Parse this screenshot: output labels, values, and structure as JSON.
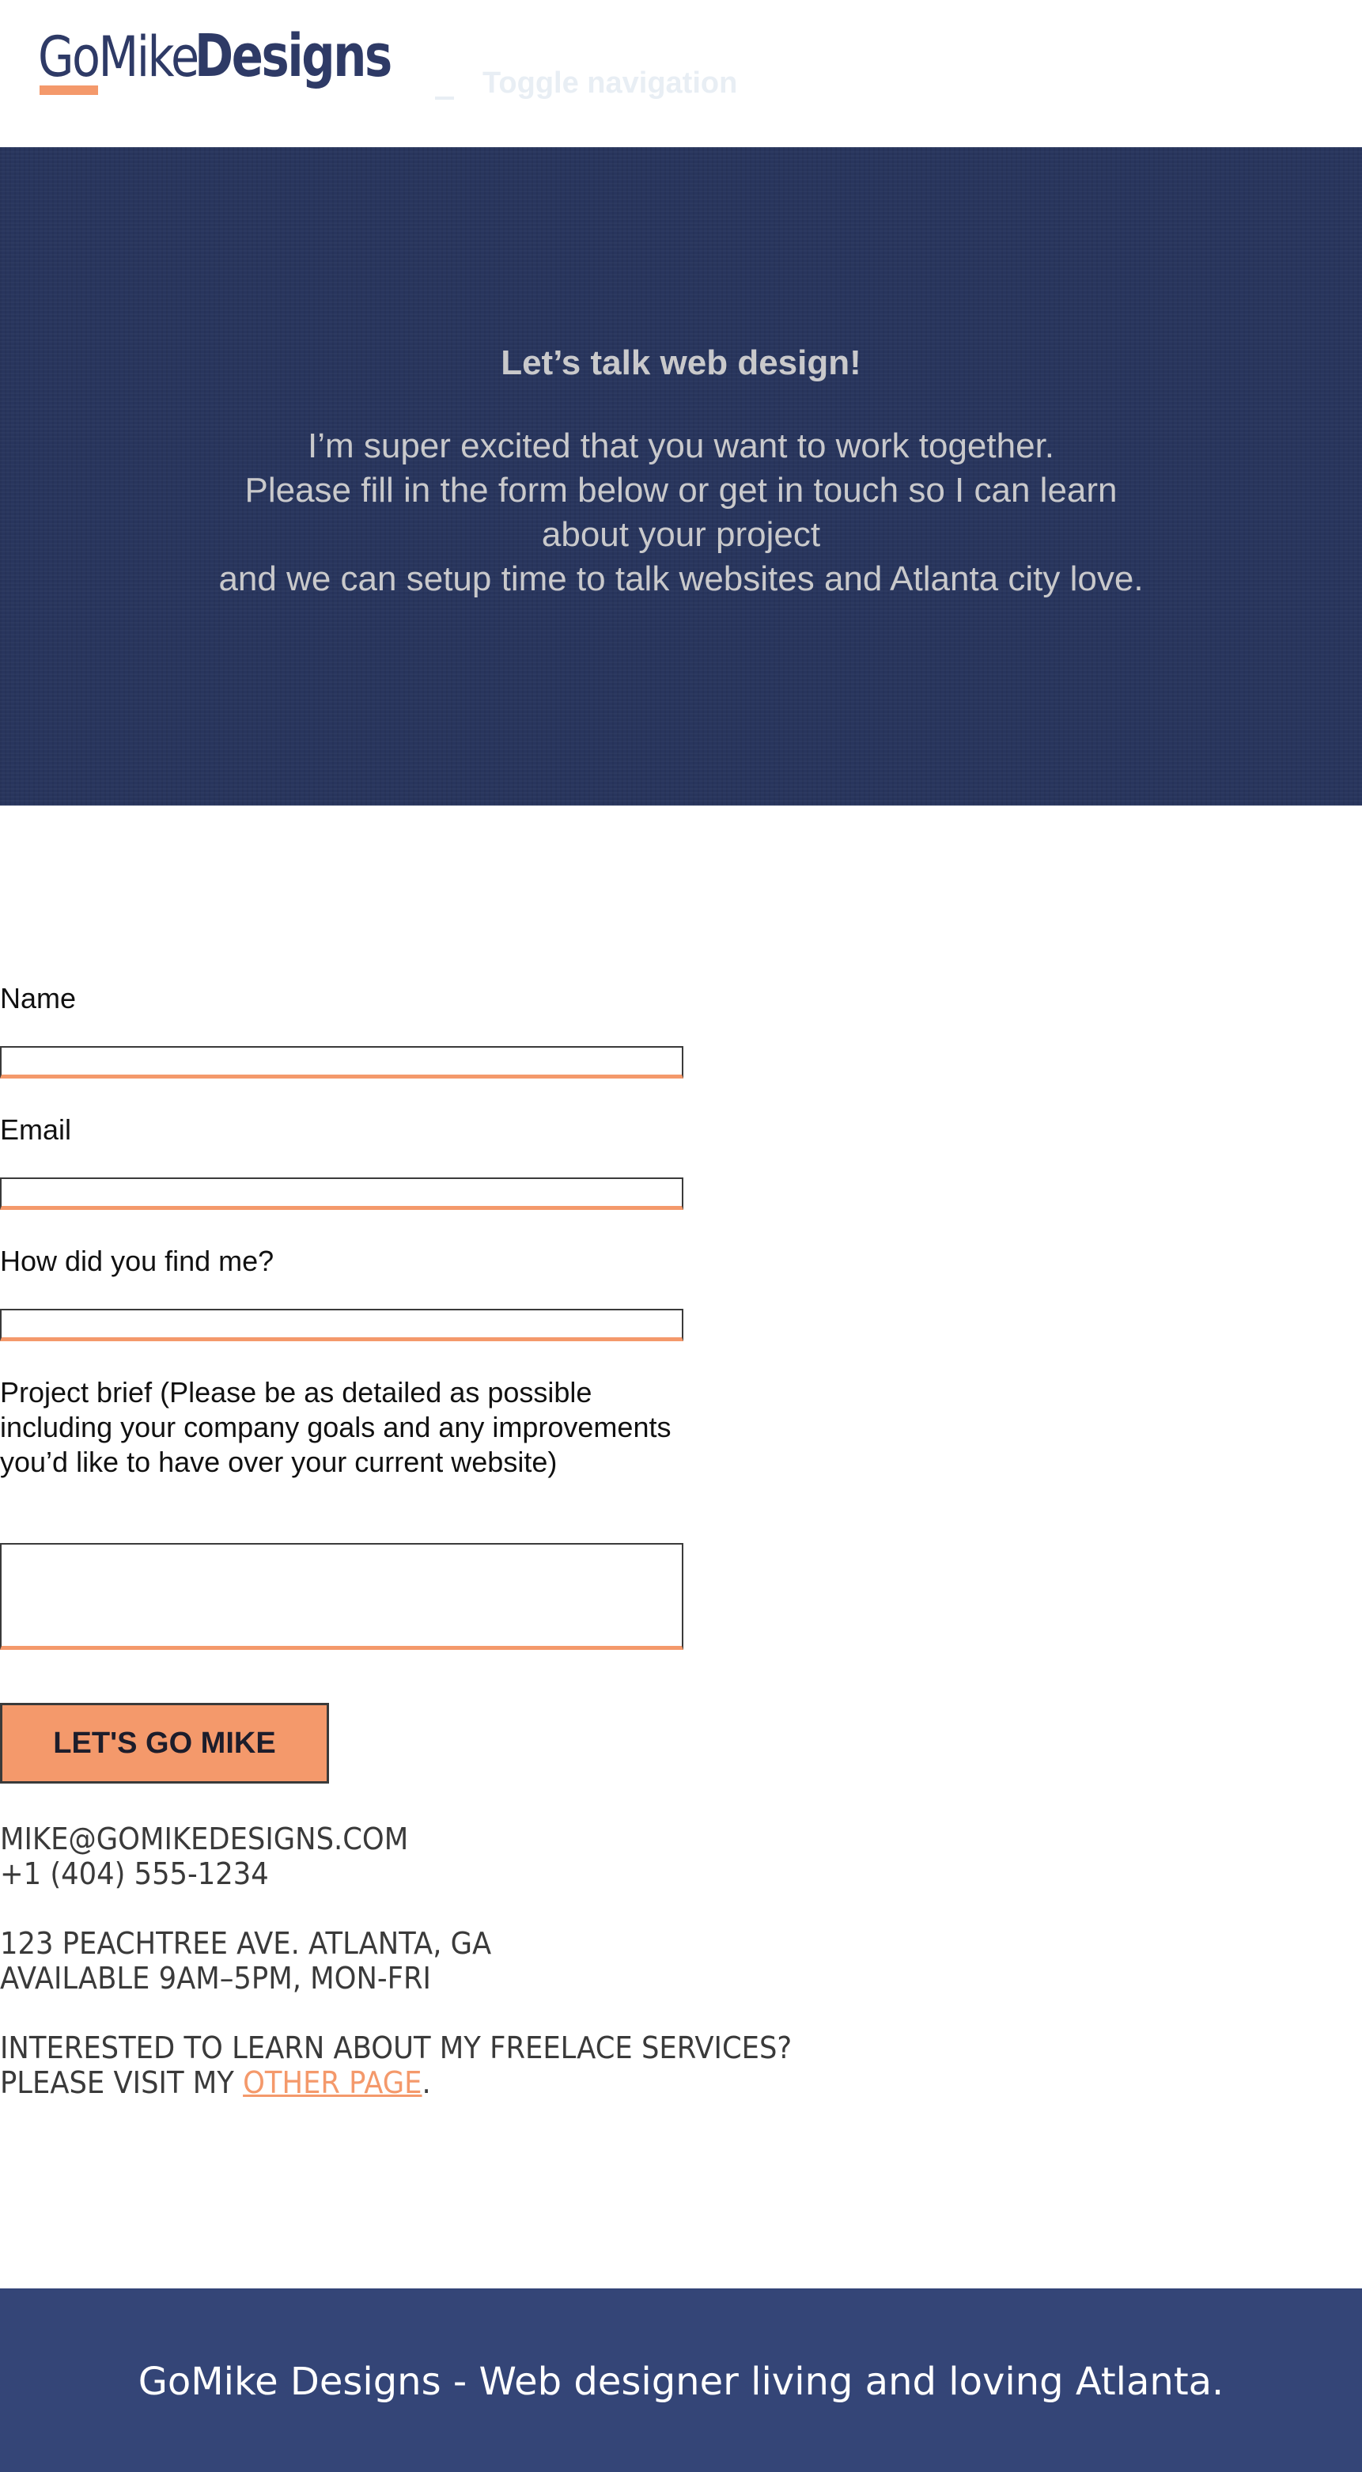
{
  "header": {
    "logo_light": "GoMike",
    "logo_bold": "Designs",
    "nav_toggle_label": "Toggle navigation"
  },
  "hero": {
    "title": "Let’s talk web design!",
    "line1": "I’m super excited that you want to work together.",
    "line2": "Please fill in the form below or get in touch so I can learn about your project",
    "line3": "and we can setup time to  talk websites and Atlanta city love."
  },
  "form": {
    "name_label": "Name",
    "name_value": "",
    "email_label": "Email",
    "email_value": "",
    "source_label": "How did you find me?",
    "source_value": "",
    "brief_label": "Project brief (Please be as detailed as possible including your company goals and any improvements you’d like to have over your current website)",
    "brief_value": "",
    "submit_label": "LET'S GO MIKE"
  },
  "contact": {
    "email": "MIKE@GOMIKEDESIGNS.COM",
    "phone": "+1 (404) 555-1234",
    "address": "123 PEACHTREE AVE. ATLANTA, GA",
    "hours": "AVAILABLE 9AM–5PM, MON-FRI",
    "services_question": "INTERESTED TO LEARN ABOUT MY FREELACE SERVICES?",
    "visit_prefix": "PLEASE VISIT MY ",
    "visit_link": "OTHER PAGE",
    "visit_suffix": "."
  },
  "footer": {
    "tagline": "GoMike Designs - Web designer living and loving Atlanta."
  },
  "colors": {
    "navy": "#28355d",
    "footer_navy": "#344577",
    "accent": "#f4996b",
    "logo": "#2e3a66"
  },
  "icons": {
    "nav_toggle": "hamburger-icon"
  }
}
